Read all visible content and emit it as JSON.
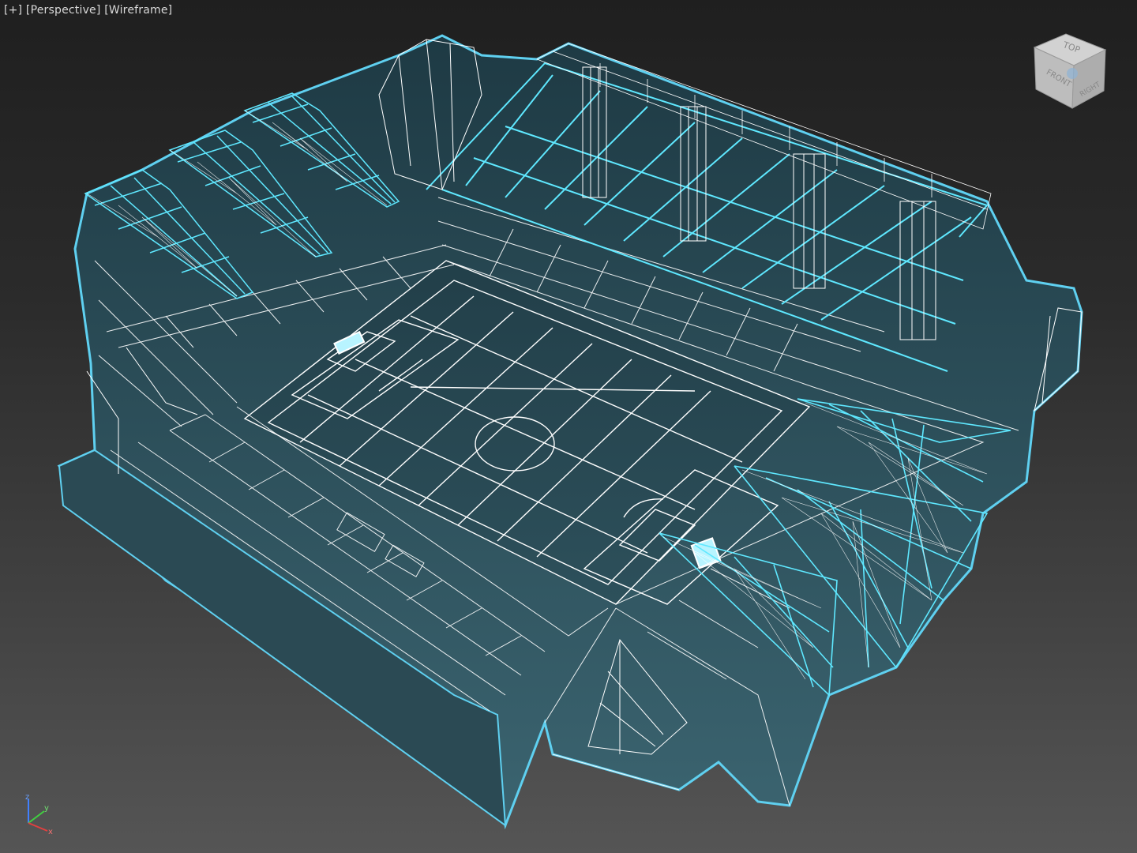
{
  "viewport": {
    "label_menu": "[+]",
    "label_view": "[Perspective]",
    "label_shading": "[Wireframe]"
  },
  "viewcube": {
    "top_face": "TOP",
    "front_face": "FRONT",
    "right_face": "RIGHT"
  },
  "axis": {
    "x": "x",
    "y": "y",
    "z": "z"
  },
  "colors": {
    "wire_white": "#ffffff",
    "wire_cyan": "#5fe8ff",
    "selection_outline": "#5fd0f0",
    "model_fill": "#2f5a66",
    "background_top": "#1f1f1f",
    "background_bottom": "#555555",
    "axis_x": "#e04040",
    "axis_y": "#40d040",
    "axis_z": "#4080ff"
  }
}
